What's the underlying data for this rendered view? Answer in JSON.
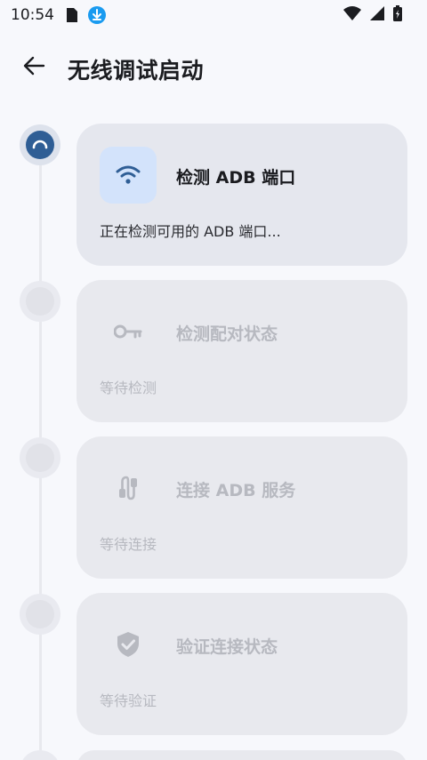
{
  "status_bar": {
    "time": "10:54",
    "icons_left": [
      "sim-card-icon",
      "download-notification-icon"
    ],
    "icons_right": [
      "wifi-icon",
      "signal-icon",
      "battery-icon"
    ]
  },
  "header": {
    "back_icon": "arrow-left-icon",
    "title": "无线调试启动"
  },
  "steps": [
    {
      "title": "检测 ADB 端口",
      "desc": "正在检测可用的 ADB 端口...",
      "icon": "wifi-icon",
      "state": "active"
    },
    {
      "title": "检测配对状态",
      "desc": "等待检测",
      "icon": "key-icon",
      "state": "pending"
    },
    {
      "title": "连接 ADB 服务",
      "desc": "等待连接",
      "icon": "cable-icon",
      "state": "pending"
    },
    {
      "title": "验证连接状态",
      "desc": "等待验证",
      "icon": "shield-check-icon",
      "state": "pending"
    }
  ],
  "colors": {
    "accent": "#2f5e95",
    "icon_box": "#d3e3fb",
    "card_bg": "#e8e9ee",
    "dim_text": "#b7b9c0",
    "download_badge": "#1a9bf0"
  }
}
